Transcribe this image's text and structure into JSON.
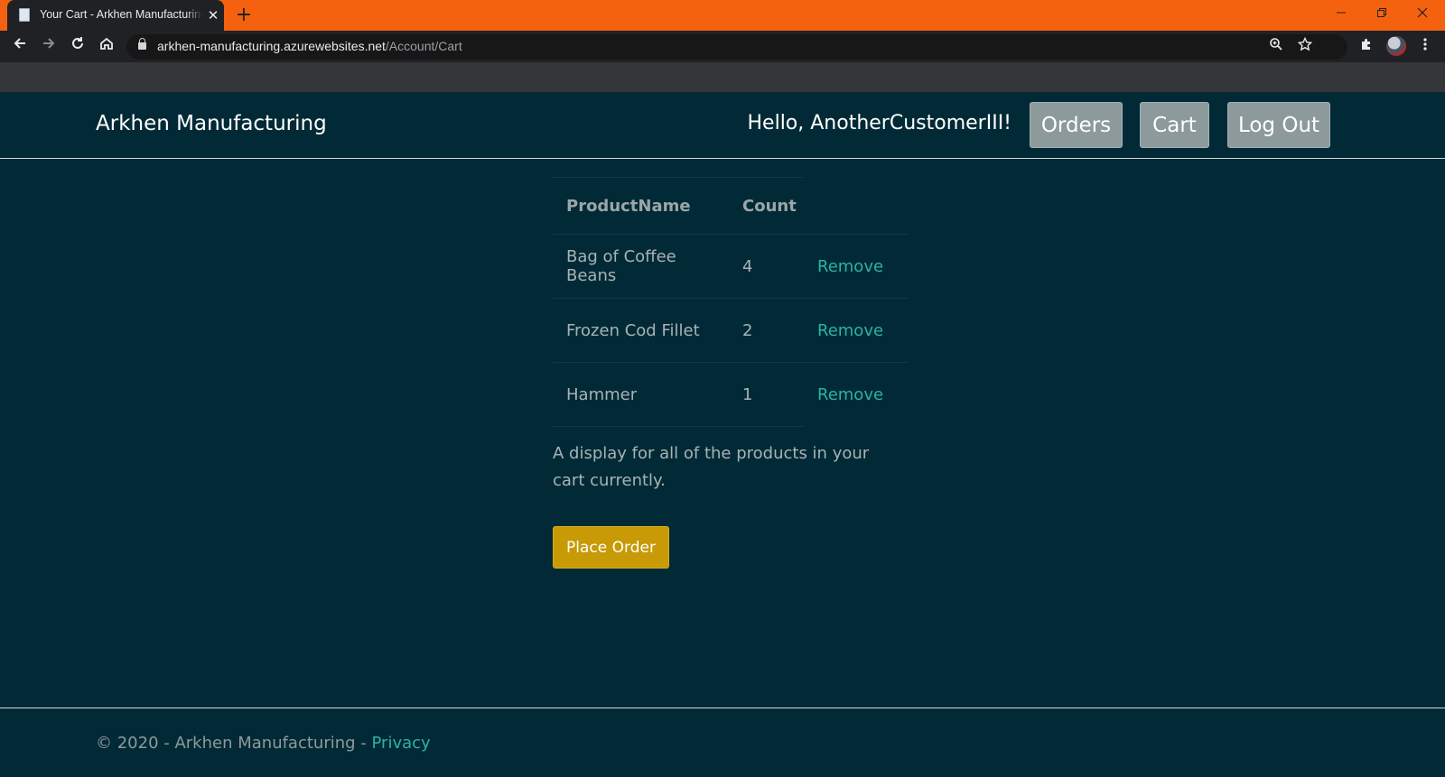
{
  "browser": {
    "tab_title": "Your Cart - Arkhen Manufacturing",
    "tab_close": "✕",
    "new_tab": "+",
    "url_host": "arkhen-manufacturing.azurewebsites.net",
    "url_path": "/Account/Cart",
    "icons": [
      "back-icon",
      "forward-icon",
      "reload-icon",
      "home-icon",
      "lock-icon",
      "zoom-icon",
      "star-icon",
      "extensions-icon",
      "profile-avatar",
      "menu-icon"
    ],
    "window_controls": [
      "minimize-icon",
      "restore-icon",
      "close-icon"
    ]
  },
  "header": {
    "brand": "Arkhen Manufacturing",
    "greeting": "Hello, AnotherCustomerIII!",
    "nav": {
      "orders": "Orders",
      "cart": "Cart",
      "logout": "Log Out"
    }
  },
  "cart": {
    "columns": [
      "ProductName",
      "Count"
    ],
    "items": [
      {
        "name": "Bag of Coffee Beans",
        "count": "4",
        "action": "Remove"
      },
      {
        "name": "Frozen Cod Fillet",
        "count": "2",
        "action": "Remove"
      },
      {
        "name": "Hammer",
        "count": "1",
        "action": "Remove"
      }
    ],
    "description": "A display for all of the products in your cart currently.",
    "place_order": "Place Order"
  },
  "footer": {
    "copyright": "© 2020 - Arkhen Manufacturing - ",
    "privacy": "Privacy"
  },
  "colors": {
    "page_bg": "#012a36",
    "tab_strip": "#f5620f",
    "link": "#2bb3a0",
    "nav_button": "#8c9a9c",
    "order_button": "#c79a06"
  }
}
